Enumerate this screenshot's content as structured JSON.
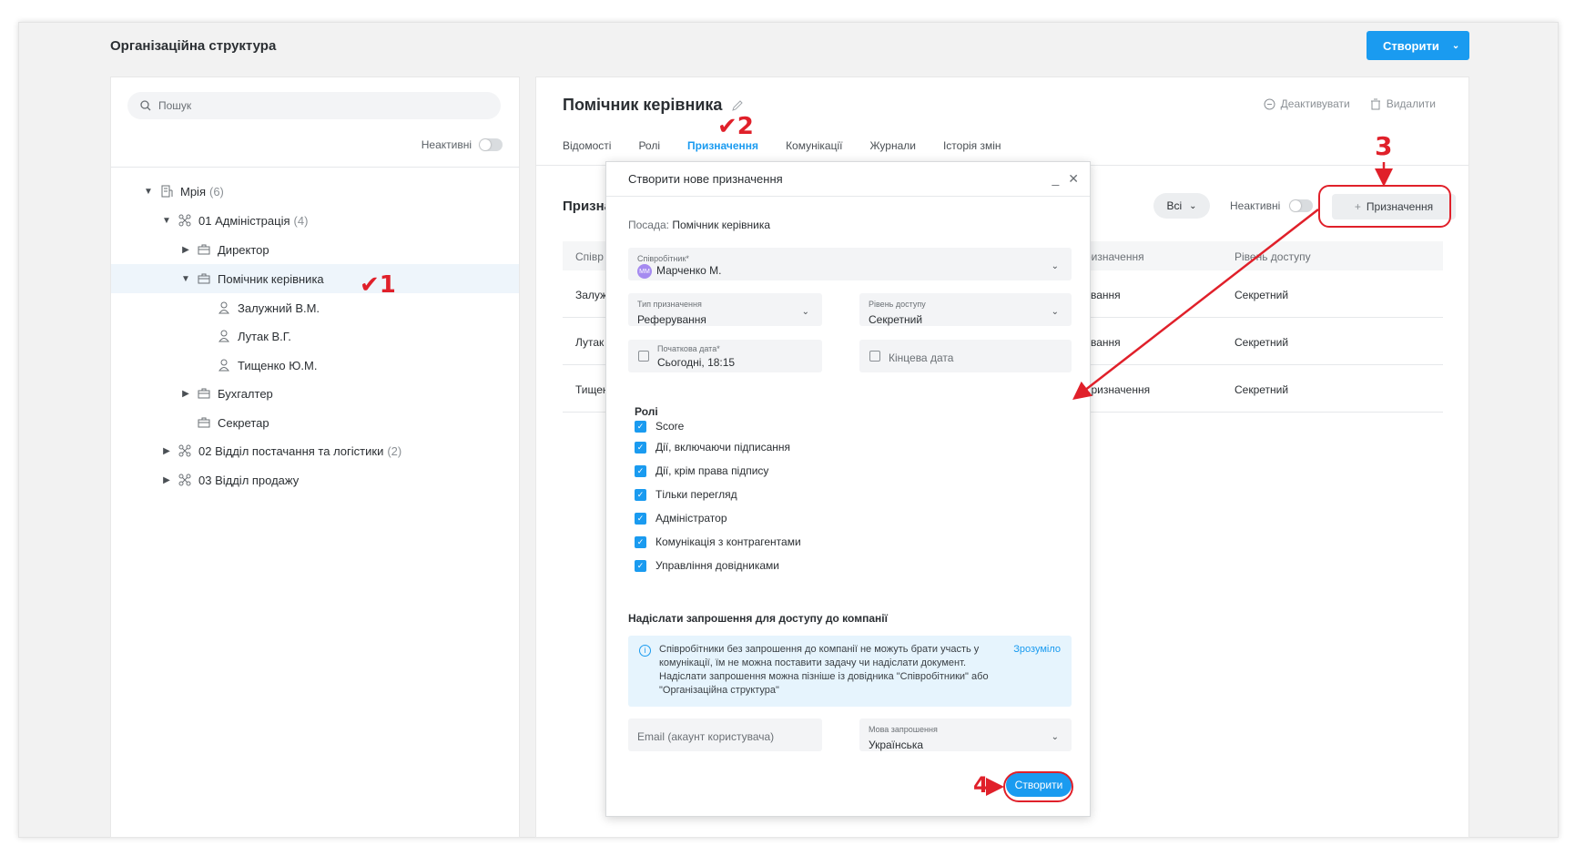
{
  "app": {
    "title": "Організаційна структура",
    "create_label": "Створити"
  },
  "tree": {
    "search_placeholder": "Пошук",
    "inactive_label": "Неактивні",
    "items": [
      {
        "label": "Мрія",
        "count": "(6)"
      },
      {
        "label": "01 Адміністрація",
        "count": "(4)"
      },
      {
        "label": "Директор"
      },
      {
        "label": "Помічник керівника"
      },
      {
        "label": "Залужний В.М."
      },
      {
        "label": "Лутак В.Г."
      },
      {
        "label": "Тищенко Ю.М."
      },
      {
        "label": "Бухгалтер"
      },
      {
        "label": "Секретар"
      },
      {
        "label": "02 Відділ постачання та логістики",
        "count": "(2)"
      },
      {
        "label": "03 Відділ продажу"
      }
    ]
  },
  "position": {
    "title": "Помічник керівника",
    "deactivate": "Деактивувати",
    "delete": "Видалити",
    "tabs": [
      "Відомості",
      "Ролі",
      "Призначення",
      "Комунікації",
      "Журнали",
      "Історія змін"
    ],
    "section_title": "Призна",
    "filter_all": "Всі",
    "inactive_label": "Неактивні",
    "add_label": "Призначення",
    "table": {
      "headers": [
        "Співр",
        "ризначення",
        "Рівень доступу"
      ],
      "rows": [
        {
          "c1": "Залуж",
          "c2": "ування",
          "c3": "Секретний"
        },
        {
          "c1": "Лутак",
          "c2": "ування",
          "c3": "Секретний"
        },
        {
          "c1": "Тищен",
          "c2": "призначення",
          "c3": "Секретний"
        }
      ]
    }
  },
  "modal": {
    "title": "Створити нове призначення",
    "position_label": "Посада:",
    "position_value": "Помічник керівника",
    "employee": {
      "label": "Співробітник*",
      "initials": "ММ",
      "value": "Марченко М."
    },
    "type": {
      "label": "Тип призначення",
      "value": "Реферування"
    },
    "access": {
      "label": "Рівень доступу",
      "value": "Секретний"
    },
    "start": {
      "label": "Початкова дата*",
      "value": "Сьогодні, 18:15"
    },
    "end": {
      "placeholder": "Кінцева дата"
    },
    "roles_title": "Ролі",
    "roles": [
      "Score",
      "Дії, включаючи підписання",
      "Дії, крім права підпису",
      "Тільки перегляд",
      "Адміністратор",
      "Комунікація з контрагентами",
      "Управління довідниками"
    ],
    "invite_title": "Надіслати запрошення для доступу до компанії",
    "info_text": "Співробітники без запрошення до компанії не можуть брати участь у комунікації, їм не можна поставити задачу чи надіслати документ. Надіслати запрошення можна пізніше із довідника \"Співробітники\" або \"Організаційна структура\"",
    "info_ok": "Зрозуміло",
    "email_placeholder": "Email (акаунт користувача)",
    "lang": {
      "label": "Мова запрошення",
      "value": "Українська"
    },
    "create_label": "Створити"
  },
  "annotations": {
    "n1": "1",
    "n2": "2",
    "n3": "3",
    "n4": "4",
    "color": "#e0202a"
  },
  "colors": {
    "accent": "#1a9bf0"
  }
}
